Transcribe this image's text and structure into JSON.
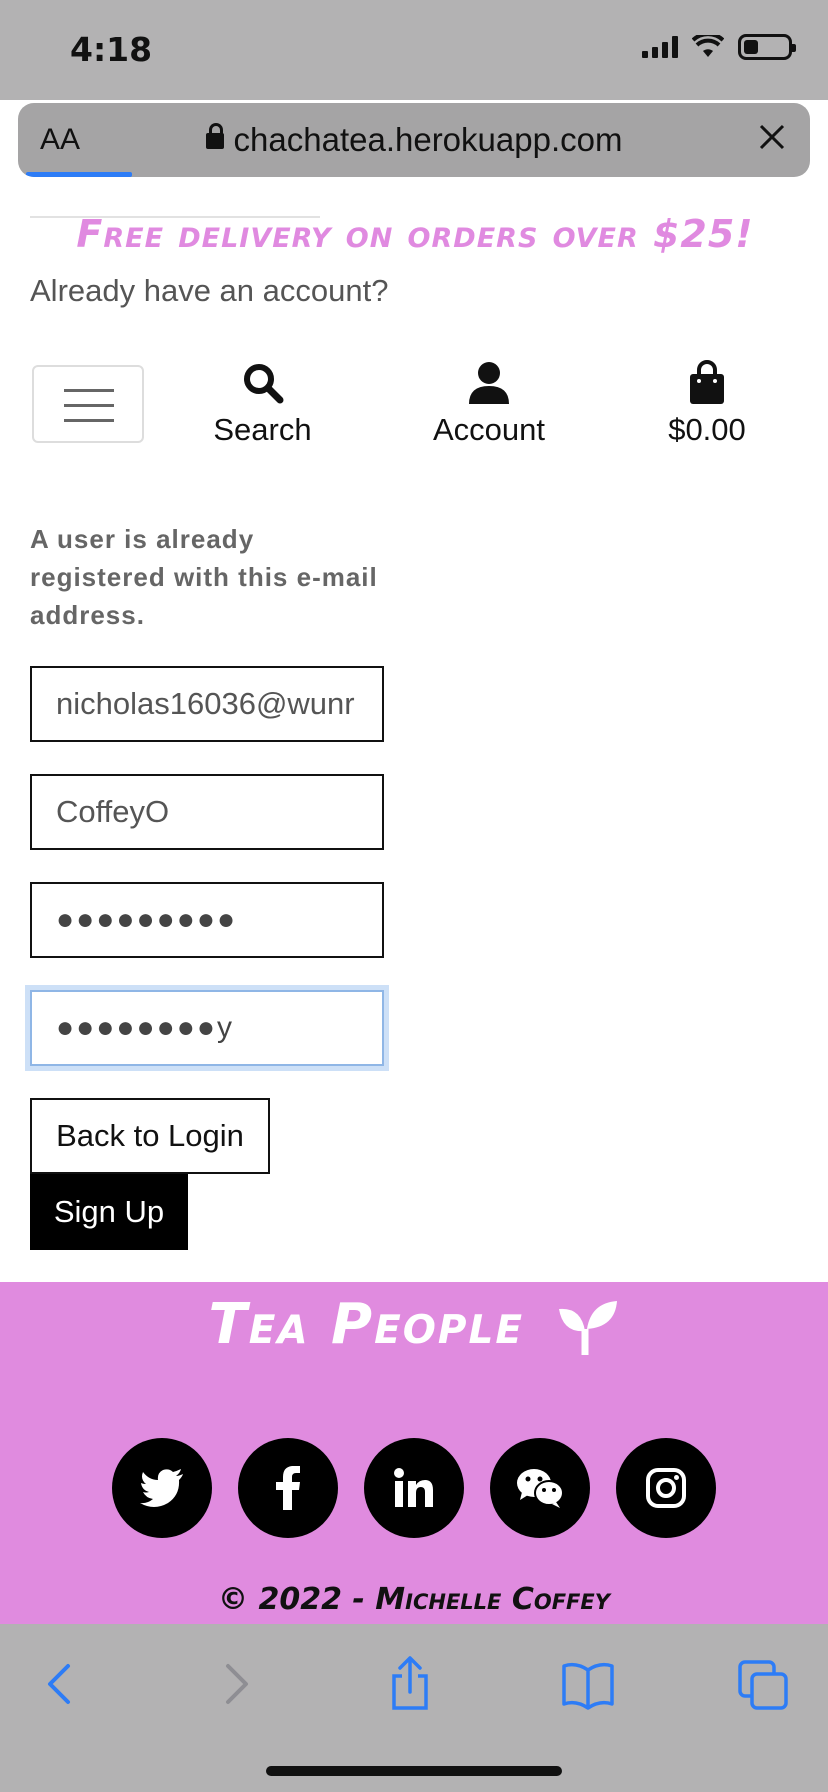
{
  "status_bar": {
    "time": "4:18"
  },
  "url_bar": {
    "text_size_label": "AA",
    "domain": "chachatea.herokuapp.com"
  },
  "banner": {
    "promo": "Free delivery on orders over $25!",
    "already_account": "Already have an account?"
  },
  "nav": {
    "search_label": "Search",
    "account_label": "Account",
    "cart_total": "$0.00"
  },
  "form": {
    "error_message": "A user is already registered with this e-mail address.",
    "email_value": "nicholas16036@wunr",
    "username_value": "CoffeyO",
    "password_value": "●●●●●●●●●",
    "password_confirm_value": "●●●●●●●●y",
    "back_button_label": "Back to Login",
    "signup_button_label": "Sign Up"
  },
  "footer": {
    "brand": "Tea People",
    "socials": [
      "twitter-icon",
      "facebook-icon",
      "linkedin-icon",
      "wechat-icon",
      "instagram-icon"
    ],
    "copyright": "© 2022 - Michelle Coffey"
  },
  "colors": {
    "accent_pink": "#e08bdf",
    "promo_pink": "#e08ae0",
    "focus_blue": "#8fb6e6",
    "safari_blue": "#2d7cf6"
  }
}
